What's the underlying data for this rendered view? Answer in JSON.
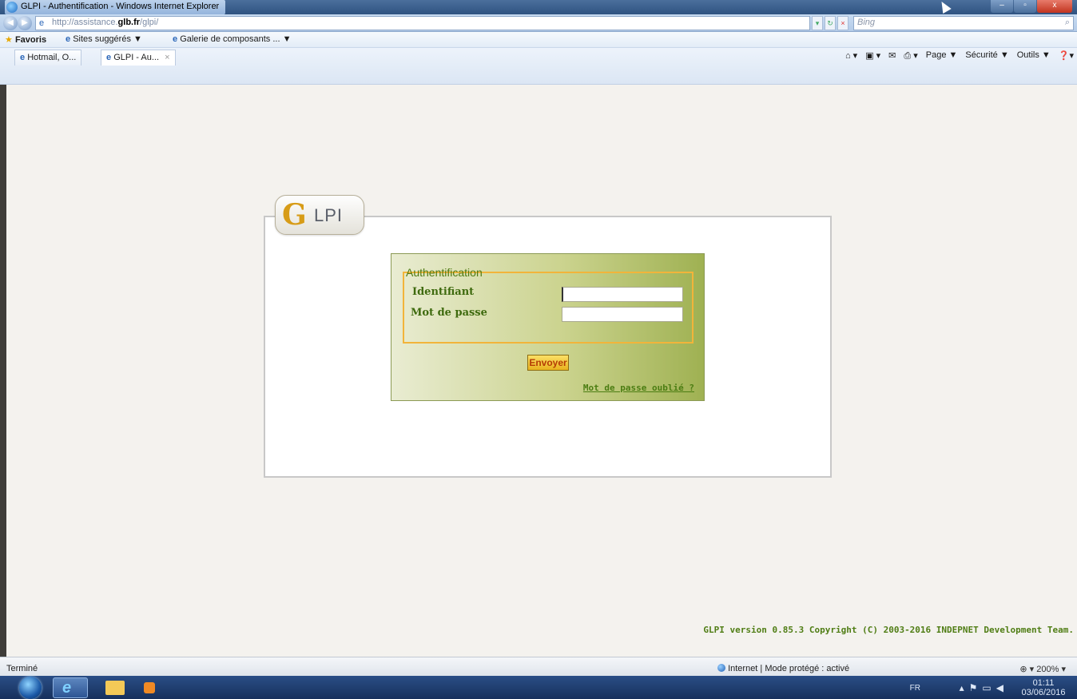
{
  "window": {
    "title": "GLPI - Authentification - Windows Internet Explorer"
  },
  "address": {
    "url_prefix": "http://assistance.",
    "url_host": "glb.fr",
    "url_suffix": "/glpi/",
    "search_placeholder": "Bing"
  },
  "favorites": {
    "label": "Favoris",
    "items": [
      "Sites suggérés ▼",
      "Galerie de composants ...  ▼"
    ]
  },
  "tabs": [
    {
      "label": "Hotmail, O..."
    },
    {
      "label": "GLPI - Au...",
      "close": "×"
    }
  ],
  "commands": [
    "Page ▼",
    "Sécurité ▼",
    "Outils ▼"
  ],
  "login": {
    "logo_g": "G",
    "logo_text": "LPI",
    "legend": "Authentification",
    "username_label": "Identifiant",
    "password_label": "Mot de passe",
    "username_value": "",
    "password_value": "",
    "submit_label": "Envoyer",
    "forgot_link": "Mot de passe oublié ?"
  },
  "footer": {
    "copyright": "GLPI version 0.85.3 Copyright (C) 2003-2016 INDEPNET Development Team."
  },
  "statusbar": {
    "status": "Terminé",
    "zone": "Internet | Mode protégé : activé",
    "zoom": "200%"
  },
  "taskbar": {
    "language": "FR",
    "time": "01:11",
    "date": "03/06/2016"
  },
  "colors": {
    "accent_green": "#4f7d14",
    "button_yellow": "#e9b21e",
    "fieldset_orange": "#f2b43a"
  }
}
